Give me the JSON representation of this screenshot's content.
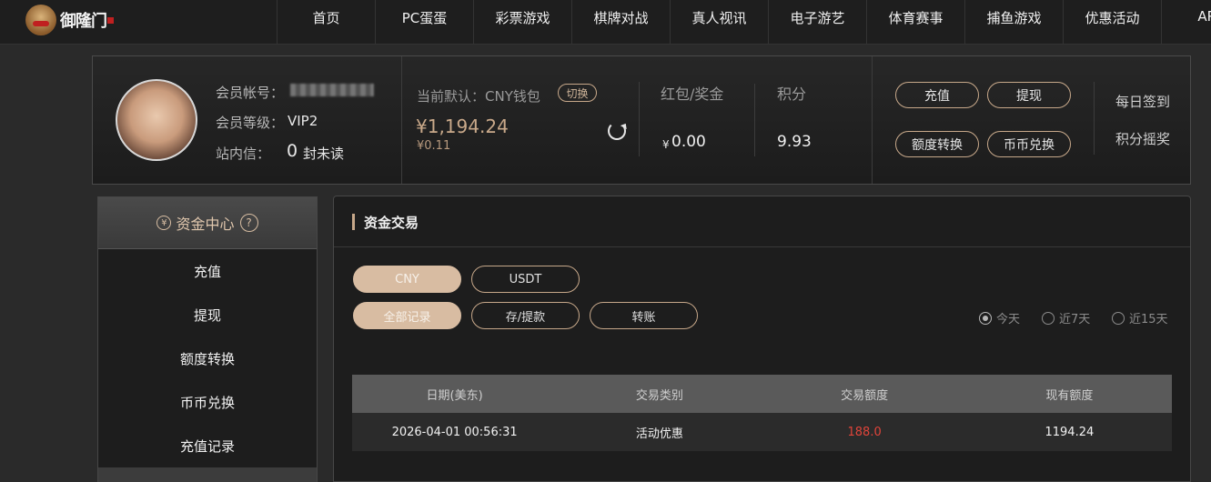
{
  "brand": {
    "logo_text": "御隆门"
  },
  "nav": {
    "items": [
      "首页",
      "PC蛋蛋",
      "彩票游戏",
      "棋牌对战",
      "真人视讯",
      "电子游艺",
      "体育赛事",
      "捕鱼游戏",
      "优惠活动",
      "APP"
    ]
  },
  "member": {
    "account_label": "会员帐号：",
    "level_label": "会员等级：",
    "level_value": "VIP2",
    "message_label": "站内信：",
    "unread_count": "0",
    "unread_text": "封未读",
    "wallet_label": "当前默认：CNY钱包",
    "switch_label": "切换",
    "balance": "¥1,194.24",
    "balance_sub": "¥0.11",
    "bonus_label": "红包/奖金",
    "bonus_currency": "¥",
    "bonus_value": "0.00",
    "points_label": "积分",
    "points_value": "9.93",
    "buttons": {
      "deposit": "充值",
      "withdraw": "提现",
      "transfer": "额度转换",
      "exchange": "币币兑换"
    },
    "links": {
      "checkin": "每日签到",
      "points_shake": "积分摇奖"
    }
  },
  "sidebar": {
    "title": "资金中心",
    "currency_icon": "¥",
    "help_icon": "?",
    "items": [
      "充值",
      "提现",
      "额度转换",
      "币币兑换",
      "充值记录"
    ]
  },
  "main": {
    "title": "资金交易",
    "currency_tabs": [
      "CNY",
      "USDT"
    ],
    "type_tabs": [
      "全部记录",
      "存/提款",
      "转账"
    ],
    "date_filters": [
      "今天",
      "近7天",
      "近15天"
    ],
    "selected_date_filter": "今天",
    "table": {
      "headers": [
        "日期(美东)",
        "交易类别",
        "交易额度",
        "现有额度"
      ],
      "rows": [
        [
          "2026-04-01 00:56:31",
          "活动优惠",
          "188.0",
          "1194.24"
        ]
      ]
    }
  },
  "colors": {
    "accent": "#c7a88a",
    "accent_fill": "#d8bca2",
    "amount_red": "#e0443a",
    "background": "#2a2a2a"
  }
}
